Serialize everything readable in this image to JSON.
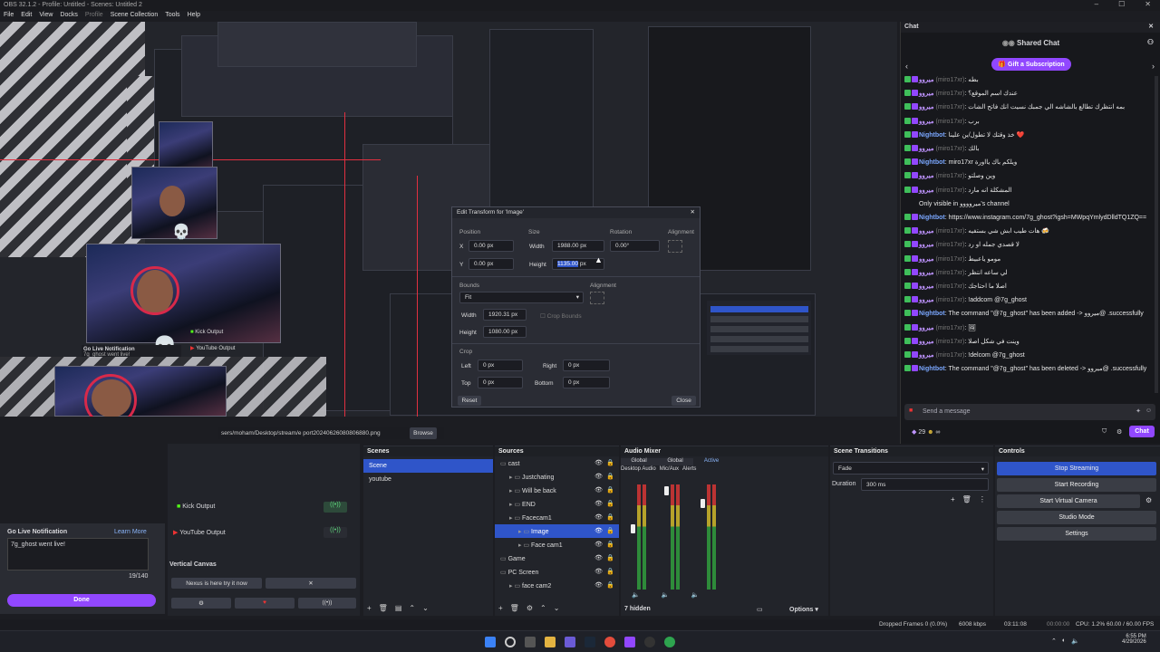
{
  "title_bar": {
    "text": "OBS 32.1.2 - Profile: Untitled - Scenes: Untitled 2"
  },
  "menu": [
    "File",
    "Edit",
    "View",
    "Docks",
    "Profile",
    "Scene Collection",
    "Tools",
    "Help"
  ],
  "preview": {
    "skull": "💀",
    "bottom_path": "sers/moham/Desktop/stream/e port20240626080806880.png",
    "browse_label": "Browse",
    "kick_output": "Kick Output",
    "youtube_output": "YouTube Output",
    "go_live_small": "Go Live Notification",
    "go_live_small_text": "7g_ghost went live!"
  },
  "transform_dialog": {
    "title": "Edit Transform for 'Image'",
    "position_label": "Position",
    "size_label": "Size",
    "rotation_label": "Rotation",
    "alignment_label": "Alignment",
    "x_label": "X",
    "x_value": "0.00 px",
    "y_label": "Y",
    "y_value": "0.00 px",
    "width_label": "Width",
    "width_value": "1988.00 px",
    "height_label": "Height",
    "height_value": "1135.00",
    "height_suffix": "px",
    "rotation_value": "0.00°",
    "bounds_label": "Bounds",
    "bounds_value": "Fit",
    "bounds_alignment_label": "Alignment",
    "bwidth_value": "1920.31 px",
    "bheight_value": "1080.00 px",
    "crop_bounds_label": "Crop Bounds",
    "crop_label": "Crop",
    "left_label": "Left",
    "left_value": "0 px",
    "right_label": "Right",
    "right_value": "0 px",
    "top_label": "Top",
    "top_value": "0 px",
    "bottom_label": "Bottom",
    "bottom_value": "0 px",
    "reset_label": "Reset",
    "close_label": "Close"
  },
  "chat": {
    "header": "Chat",
    "shared_chat": "Shared Chat",
    "gift": "Gift a Subscription",
    "messages": [
      {
        "user": "ميروو",
        "alt": "(miro17xr)",
        "text": "بطه"
      },
      {
        "user": "ميروو",
        "alt": "(miro17xr)",
        "text": "عندك اسم الموقع؟"
      },
      {
        "user": "ميروو",
        "alt": "(miro17xr)",
        "text": "بمه انتظرك تطالع بالشاشه الي جمبك نسيت انك فاتح الشات"
      },
      {
        "user": "ميروو",
        "alt": "(miro17xr)",
        "text": "برب"
      },
      {
        "user": "Nightbot",
        "alt": "",
        "text": "خذ وقتك لا تطول/ين علينا ❤️"
      },
      {
        "user": "ميروو",
        "alt": "(miro17xr)",
        "text": "بالك"
      },
      {
        "user": "Nightbot",
        "alt": "",
        "text": "miro17xr ويلكم باك يااورة"
      },
      {
        "user": "ميروو",
        "alt": "(miro17xr)",
        "text": "وين وصلتو"
      },
      {
        "user": "ميروو",
        "alt": "(miro17xr)",
        "text": "المشكلة انه مارد"
      },
      {
        "user": "",
        "alt": "",
        "text": "Only visible in ميروووو's channel"
      },
      {
        "user": "Nightbot",
        "alt": "",
        "text": "https://www.instagram.com/7g_ghost?igsh=MWpqYmlydDlldTQ1ZQ=="
      },
      {
        "user": "ميروو",
        "alt": "(miro17xr)",
        "text": "هات طيب ابش شي بستفيه 🍻"
      },
      {
        "user": "ميروو",
        "alt": "(miro17xr)",
        "text": "لا قصدي جمله او رد"
      },
      {
        "user": "ميروو",
        "alt": "(miro17xr)",
        "text": "مومو ياعبيط"
      },
      {
        "user": "ميروو",
        "alt": "(miro17xr)",
        "text": "لي ساعه انتظر"
      },
      {
        "user": "ميروو",
        "alt": "(miro17xr)",
        "text": "اصلا ما احتاجك"
      },
      {
        "user": "ميروو",
        "alt": "(miro17xr)",
        "text": "!addcom @7g_ghost"
      },
      {
        "user": "Nightbot",
        "alt": "",
        "text": "The command \"@7g_ghost\" has been added -> ميروو@ .successfully"
      },
      {
        "user": "ميروو",
        "alt": "(miro17xr)",
        "text": "🖼"
      },
      {
        "user": "ميروو",
        "alt": "(miro17xr)",
        "text": "وينت في شكل اصلا"
      },
      {
        "user": "ميروو",
        "alt": "(miro17xr)",
        "text": "!delcom @7g_ghost"
      },
      {
        "user": "Nightbot",
        "alt": "",
        "text": "The command \"@7g_ghost\" has been deleted -> ميروو@ .successfully"
      }
    ],
    "placeholder": "Send a message",
    "points": "29",
    "chat_btn": "Chat",
    "infinity": "∞"
  },
  "scenes": {
    "title": "Scenes",
    "items": [
      "Scene",
      "youtube"
    ]
  },
  "sources": {
    "title": "Sources",
    "items": [
      {
        "name": "cast",
        "indent": 0
      },
      {
        "name": "Justchating",
        "indent": 1
      },
      {
        "name": "Will be back",
        "indent": 1
      },
      {
        "name": "END",
        "indent": 1
      },
      {
        "name": "Facecam1",
        "indent": 1
      },
      {
        "name": "Image",
        "indent": 2
      },
      {
        "name": "Face cam1",
        "indent": 2
      },
      {
        "name": "Game",
        "indent": 0
      },
      {
        "name": "PC Screen",
        "indent": 0
      },
      {
        "name": "face cam2",
        "indent": 1
      }
    ]
  },
  "audio": {
    "title": "Audio Mixer",
    "tabs": [
      "Global",
      "Global",
      "Active"
    ],
    "channels": [
      "Desktop Audio",
      "Mic/Aux",
      "Alerts"
    ],
    "hidden": "7 hidden",
    "options": "Options"
  },
  "transitions": {
    "title": "Scene Transitions",
    "value": "Fade",
    "duration_label": "Duration",
    "duration_value": "300 ms"
  },
  "controls": {
    "title": "Controls",
    "buttons": [
      "Stop Streaming",
      "Start Recording",
      "Start Virtual Camera",
      "Studio Mode",
      "Settings"
    ]
  },
  "go_live": {
    "title": "Go Live Notification",
    "learn": "Learn More",
    "text": "7g_ghost went live!",
    "counter": "19/140",
    "done": "Done"
  },
  "vertical_canvas": {
    "title": "Vertical Canvas",
    "nexus": "Nexus is here try it now"
  },
  "status": {
    "dropped": "Dropped Frames 0 (0.0%)",
    "kbps": "6008 kbps",
    "time1": "03:11:08",
    "time2": "00:00:00",
    "cpu": "CPU: 1.2%",
    "fps": "60.00 / 60.00 FPS"
  },
  "taskbar": {
    "time": "6:55 PM",
    "date": "4/29/2026"
  }
}
